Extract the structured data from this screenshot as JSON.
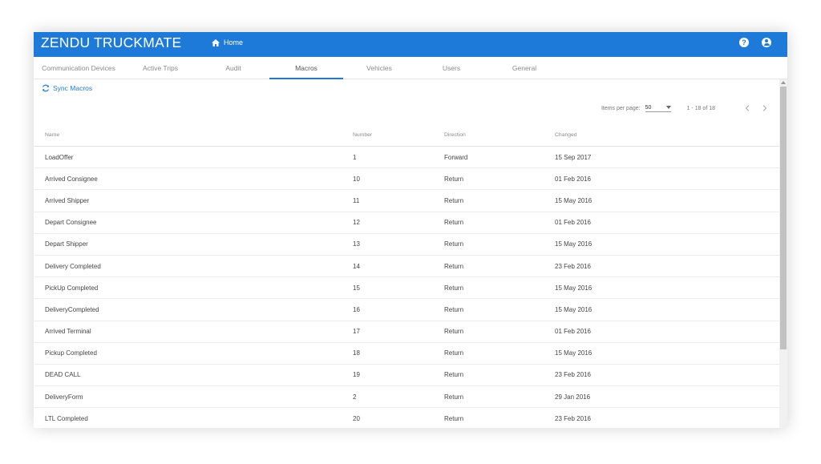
{
  "app": {
    "title": "ZENDU TRUCKMATE",
    "home_label": "Home"
  },
  "tabs": [
    {
      "label": "Communication Devices"
    },
    {
      "label": "Active Trips"
    },
    {
      "label": "Audit"
    },
    {
      "label": "Macros"
    },
    {
      "label": "Vehicles"
    },
    {
      "label": "Users"
    },
    {
      "label": "General"
    }
  ],
  "active_tab": "Macros",
  "toolbar": {
    "sync_label": "Sync Macros"
  },
  "pagination": {
    "items_per_page_label": "Items per page:",
    "items_per_page": "50",
    "range": "1 - 18 of 18"
  },
  "table": {
    "headers": {
      "name": "Name",
      "number": "Number",
      "direction": "Direction",
      "changed": "Changed"
    },
    "rows": [
      {
        "name": "LoadOffer",
        "number": "1",
        "direction": "Forward",
        "changed": "15 Sep 2017"
      },
      {
        "name": "Arrived Consignee",
        "number": "10",
        "direction": "Return",
        "changed": "01 Feb 2016"
      },
      {
        "name": "Arrived Shipper",
        "number": "11",
        "direction": "Return",
        "changed": "15 May 2016"
      },
      {
        "name": "Depart Consignee",
        "number": "12",
        "direction": "Return",
        "changed": "01 Feb 2016"
      },
      {
        "name": "Depart Shipper",
        "number": "13",
        "direction": "Return",
        "changed": "15 May 2016"
      },
      {
        "name": "Delivery Completed",
        "number": "14",
        "direction": "Return",
        "changed": "23 Feb 2016"
      },
      {
        "name": "PickUp Completed",
        "number": "15",
        "direction": "Return",
        "changed": "15 May 2016"
      },
      {
        "name": "DeliveryCompleted",
        "number": "16",
        "direction": "Return",
        "changed": "15 May 2016"
      },
      {
        "name": "Arrived Terminal",
        "number": "17",
        "direction": "Return",
        "changed": "01 Feb 2016"
      },
      {
        "name": "Pickup Completed",
        "number": "18",
        "direction": "Return",
        "changed": "15 May 2016"
      },
      {
        "name": "DEAD CALL",
        "number": "19",
        "direction": "Return",
        "changed": "23 Feb 2016"
      },
      {
        "name": "DeliveryForm",
        "number": "2",
        "direction": "Return",
        "changed": "29 Jan 2016"
      },
      {
        "name": "LTL Completed",
        "number": "20",
        "direction": "Return",
        "changed": "23 Feb 2016"
      }
    ]
  },
  "colors": {
    "primary": "#1e7ad9"
  }
}
